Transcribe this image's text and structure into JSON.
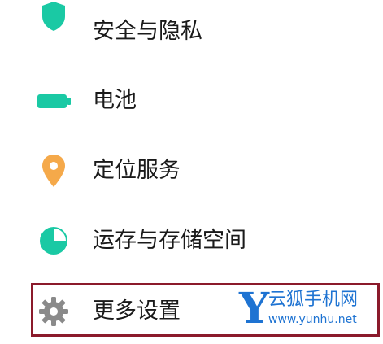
{
  "settings": {
    "items": [
      {
        "label": "安全与隐私",
        "icon": "shield-icon",
        "color": "#1ac9a4"
      },
      {
        "label": "电池",
        "icon": "battery-icon",
        "color": "#1ac9a4"
      },
      {
        "label": "定位服务",
        "icon": "location-pin-icon",
        "color": "#f5a94a"
      },
      {
        "label": "运存与存储空间",
        "icon": "pie-chart-icon",
        "color": "#1ac9a4"
      },
      {
        "label": "更多设置",
        "icon": "gear-icon",
        "color": "#8a8a8a"
      }
    ]
  },
  "highlight": {
    "color": "#8b1a2b"
  },
  "watermark": {
    "letter": "Y",
    "title": "云狐手机网",
    "url": "www.yunhu.net",
    "color": "#1e73d2"
  }
}
